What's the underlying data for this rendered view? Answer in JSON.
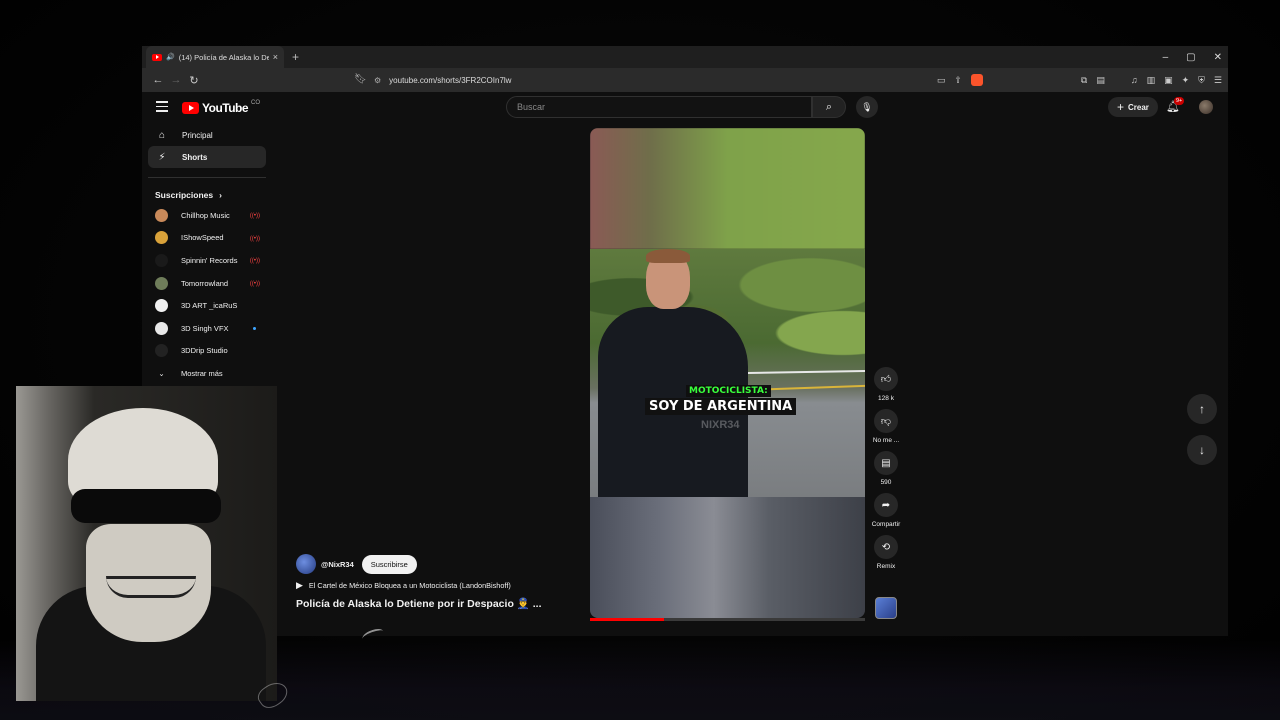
{
  "browser": {
    "tab_title": "(14) Policía de Alaska lo Detie",
    "tab_close": "×",
    "new_tab": "+",
    "window_controls": [
      "–",
      "▢",
      "✕"
    ],
    "url": "youtube.com/shorts/3FR2COIn7lw"
  },
  "header": {
    "logo_text": "YouTube",
    "logo_region": "CO",
    "search_placeholder": "Buscar",
    "create_label": "Crear",
    "notification_badge": "9+"
  },
  "sidebar": {
    "items": [
      {
        "label": "Principal",
        "icon": "home-icon"
      },
      {
        "label": "Shorts",
        "icon": "shorts-icon"
      }
    ],
    "subscriptions_title": "Suscripciones",
    "subscriptions": [
      {
        "name": "Chillhop Music",
        "live": true,
        "color": "#c98a5a"
      },
      {
        "name": "IShowSpeed",
        "live": true,
        "color": "#d9a23a"
      },
      {
        "name": "Spinnin' Records",
        "live": true,
        "color": "#1a1a1a"
      },
      {
        "name": "Tomorrowland",
        "live": true,
        "color": "#6f7d5a"
      },
      {
        "name": "3D ART _icaRuS",
        "live": false,
        "color": "#f1f1f1"
      },
      {
        "name": "3D Singh VFX",
        "live": false,
        "new_dot": true,
        "color": "#e8e8e8"
      },
      {
        "name": "3DDrip Studio",
        "live": false,
        "color": "#222222"
      }
    ],
    "show_more": "Mostrar más"
  },
  "short": {
    "caption_label": "MOTOCICLISTA:",
    "caption_main": "SOY DE ARGENTINA",
    "watermark": "NIXR34",
    "progress": 0.27
  },
  "actions": {
    "likes": "128 k",
    "dislike": "No me ...",
    "comments": "590",
    "share": "Compartir",
    "remix": "Remix"
  },
  "info": {
    "channel": "@NixR34",
    "subscribe": "Suscribirse",
    "music": "El Cartel de México Bloquea a un Motociclista (LandonBishoff)",
    "title": "Policía de Alaska lo Detiene por ir Despacio 👮‍♂️ ..."
  },
  "colors": {
    "brand": "#ff0000",
    "caption_green": "#39ff3c",
    "page_bg": "#0f0f0f"
  }
}
